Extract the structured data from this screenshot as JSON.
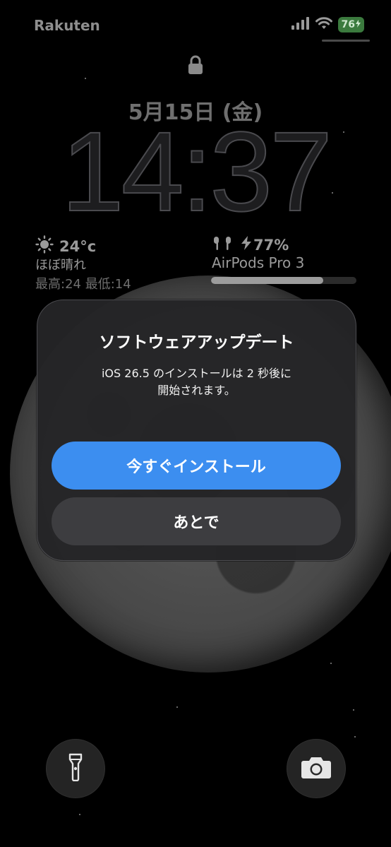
{
  "status_bar": {
    "carrier": "Rakuten",
    "battery": "76",
    "icons": [
      "signal-icon",
      "wifi-icon",
      "battery-icon"
    ]
  },
  "lock_screen": {
    "date": "5月15日 (金)",
    "time": "14:37"
  },
  "weather": {
    "temperature": "24°c",
    "condition": "ほぼ晴れ",
    "range": "最高:24 最低:14"
  },
  "airpods": {
    "battery": "77%",
    "name": "AirPods Pro 3",
    "battery_level": 0.77
  },
  "dialog": {
    "title": "ソフトウェアアップデート",
    "message": "iOS 26.5 のインストールは 2 秒後に開始されます。",
    "install_now": "今すぐインストール",
    "later": "あとで"
  },
  "colors": {
    "accent": "#3c8ef0",
    "battery": "#3b7a3e"
  }
}
